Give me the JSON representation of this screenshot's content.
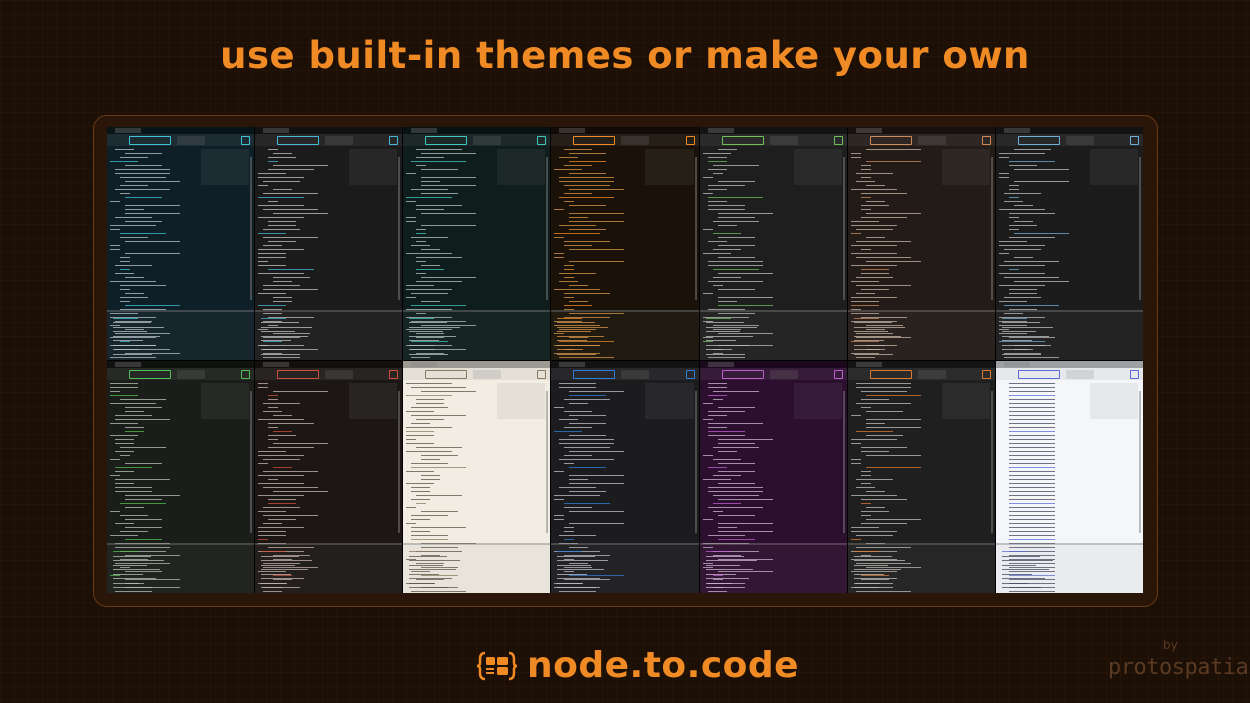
{
  "headline": "use built-in themes or make your own",
  "brand": {
    "name": "node.to.code",
    "accent": "#f08a24",
    "by": "by",
    "company": "protospatial"
  },
  "themes": [
    {
      "bg": "#0f1f27",
      "accent": "#3fc3d6",
      "text": "#b9c7cc"
    },
    {
      "bg": "#1b1b1b",
      "accent": "#46b8d8",
      "text": "#c6c6c6"
    },
    {
      "bg": "#0f1d1d",
      "accent": "#40c8c0",
      "text": "#b8c6c4"
    },
    {
      "bg": "#1a1208",
      "accent": "#f08a24",
      "text": "#d99a4a"
    },
    {
      "bg": "#1e1e1e",
      "accent": "#6fbf5a",
      "text": "#c0c0c0"
    },
    {
      "bg": "#231b17",
      "accent": "#d08a5a",
      "text": "#c8b8a8"
    },
    {
      "bg": "#1c1c1c",
      "accent": "#6fb0d8",
      "text": "#c0c0c0"
    },
    {
      "bg": "#1a1d1a",
      "accent": "#4fbf4f",
      "text": "#b8c4b8"
    },
    {
      "bg": "#1c1714",
      "accent": "#d0503a",
      "text": "#c8b8b0"
    },
    {
      "bg": "#f2ede3",
      "accent": "#8a7a60",
      "text": "#5a5044"
    },
    {
      "bg": "#1c1c1e",
      "accent": "#2f7fdc",
      "text": "#c0c4cc"
    },
    {
      "bg": "#2c0e2e",
      "accent": "#c060d0",
      "text": "#d0b8d4"
    },
    {
      "bg": "#1f1f1f",
      "accent": "#e07a30",
      "text": "#c4c0bc"
    },
    {
      "bg": "#f5f6fa",
      "accent": "#5a6ad8",
      "text": "#40465a"
    }
  ]
}
